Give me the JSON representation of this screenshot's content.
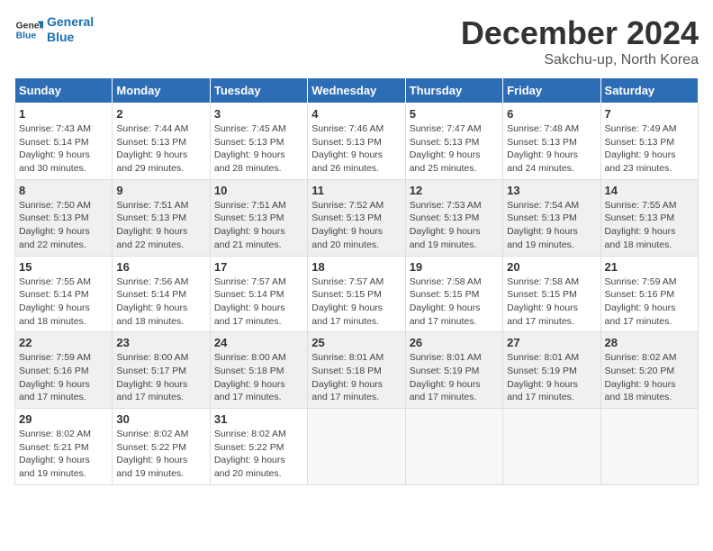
{
  "logo": {
    "line1": "General",
    "line2": "Blue"
  },
  "title": "December 2024",
  "location": "Sakchu-up, North Korea",
  "weekdays": [
    "Sunday",
    "Monday",
    "Tuesday",
    "Wednesday",
    "Thursday",
    "Friday",
    "Saturday"
  ],
  "weeks": [
    [
      {
        "day": "1",
        "info": "Sunrise: 7:43 AM\nSunset: 5:14 PM\nDaylight: 9 hours\nand 30 minutes."
      },
      {
        "day": "2",
        "info": "Sunrise: 7:44 AM\nSunset: 5:13 PM\nDaylight: 9 hours\nand 29 minutes."
      },
      {
        "day": "3",
        "info": "Sunrise: 7:45 AM\nSunset: 5:13 PM\nDaylight: 9 hours\nand 28 minutes."
      },
      {
        "day": "4",
        "info": "Sunrise: 7:46 AM\nSunset: 5:13 PM\nDaylight: 9 hours\nand 26 minutes."
      },
      {
        "day": "5",
        "info": "Sunrise: 7:47 AM\nSunset: 5:13 PM\nDaylight: 9 hours\nand 25 minutes."
      },
      {
        "day": "6",
        "info": "Sunrise: 7:48 AM\nSunset: 5:13 PM\nDaylight: 9 hours\nand 24 minutes."
      },
      {
        "day": "7",
        "info": "Sunrise: 7:49 AM\nSunset: 5:13 PM\nDaylight: 9 hours\nand 23 minutes."
      }
    ],
    [
      {
        "day": "8",
        "info": "Sunrise: 7:50 AM\nSunset: 5:13 PM\nDaylight: 9 hours\nand 22 minutes."
      },
      {
        "day": "9",
        "info": "Sunrise: 7:51 AM\nSunset: 5:13 PM\nDaylight: 9 hours\nand 22 minutes."
      },
      {
        "day": "10",
        "info": "Sunrise: 7:51 AM\nSunset: 5:13 PM\nDaylight: 9 hours\nand 21 minutes."
      },
      {
        "day": "11",
        "info": "Sunrise: 7:52 AM\nSunset: 5:13 PM\nDaylight: 9 hours\nand 20 minutes."
      },
      {
        "day": "12",
        "info": "Sunrise: 7:53 AM\nSunset: 5:13 PM\nDaylight: 9 hours\nand 19 minutes."
      },
      {
        "day": "13",
        "info": "Sunrise: 7:54 AM\nSunset: 5:13 PM\nDaylight: 9 hours\nand 19 minutes."
      },
      {
        "day": "14",
        "info": "Sunrise: 7:55 AM\nSunset: 5:13 PM\nDaylight: 9 hours\nand 18 minutes."
      }
    ],
    [
      {
        "day": "15",
        "info": "Sunrise: 7:55 AM\nSunset: 5:14 PM\nDaylight: 9 hours\nand 18 minutes."
      },
      {
        "day": "16",
        "info": "Sunrise: 7:56 AM\nSunset: 5:14 PM\nDaylight: 9 hours\nand 18 minutes."
      },
      {
        "day": "17",
        "info": "Sunrise: 7:57 AM\nSunset: 5:14 PM\nDaylight: 9 hours\nand 17 minutes."
      },
      {
        "day": "18",
        "info": "Sunrise: 7:57 AM\nSunset: 5:15 PM\nDaylight: 9 hours\nand 17 minutes."
      },
      {
        "day": "19",
        "info": "Sunrise: 7:58 AM\nSunset: 5:15 PM\nDaylight: 9 hours\nand 17 minutes."
      },
      {
        "day": "20",
        "info": "Sunrise: 7:58 AM\nSunset: 5:15 PM\nDaylight: 9 hours\nand 17 minutes."
      },
      {
        "day": "21",
        "info": "Sunrise: 7:59 AM\nSunset: 5:16 PM\nDaylight: 9 hours\nand 17 minutes."
      }
    ],
    [
      {
        "day": "22",
        "info": "Sunrise: 7:59 AM\nSunset: 5:16 PM\nDaylight: 9 hours\nand 17 minutes."
      },
      {
        "day": "23",
        "info": "Sunrise: 8:00 AM\nSunset: 5:17 PM\nDaylight: 9 hours\nand 17 minutes."
      },
      {
        "day": "24",
        "info": "Sunrise: 8:00 AM\nSunset: 5:18 PM\nDaylight: 9 hours\nand 17 minutes."
      },
      {
        "day": "25",
        "info": "Sunrise: 8:01 AM\nSunset: 5:18 PM\nDaylight: 9 hours\nand 17 minutes."
      },
      {
        "day": "26",
        "info": "Sunrise: 8:01 AM\nSunset: 5:19 PM\nDaylight: 9 hours\nand 17 minutes."
      },
      {
        "day": "27",
        "info": "Sunrise: 8:01 AM\nSunset: 5:19 PM\nDaylight: 9 hours\nand 17 minutes."
      },
      {
        "day": "28",
        "info": "Sunrise: 8:02 AM\nSunset: 5:20 PM\nDaylight: 9 hours\nand 18 minutes."
      }
    ],
    [
      {
        "day": "29",
        "info": "Sunrise: 8:02 AM\nSunset: 5:21 PM\nDaylight: 9 hours\nand 19 minutes."
      },
      {
        "day": "30",
        "info": "Sunrise: 8:02 AM\nSunset: 5:22 PM\nDaylight: 9 hours\nand 19 minutes."
      },
      {
        "day": "31",
        "info": "Sunrise: 8:02 AM\nSunset: 5:22 PM\nDaylight: 9 hours\nand 20 minutes."
      },
      {
        "day": "",
        "info": ""
      },
      {
        "day": "",
        "info": ""
      },
      {
        "day": "",
        "info": ""
      },
      {
        "day": "",
        "info": ""
      }
    ]
  ]
}
